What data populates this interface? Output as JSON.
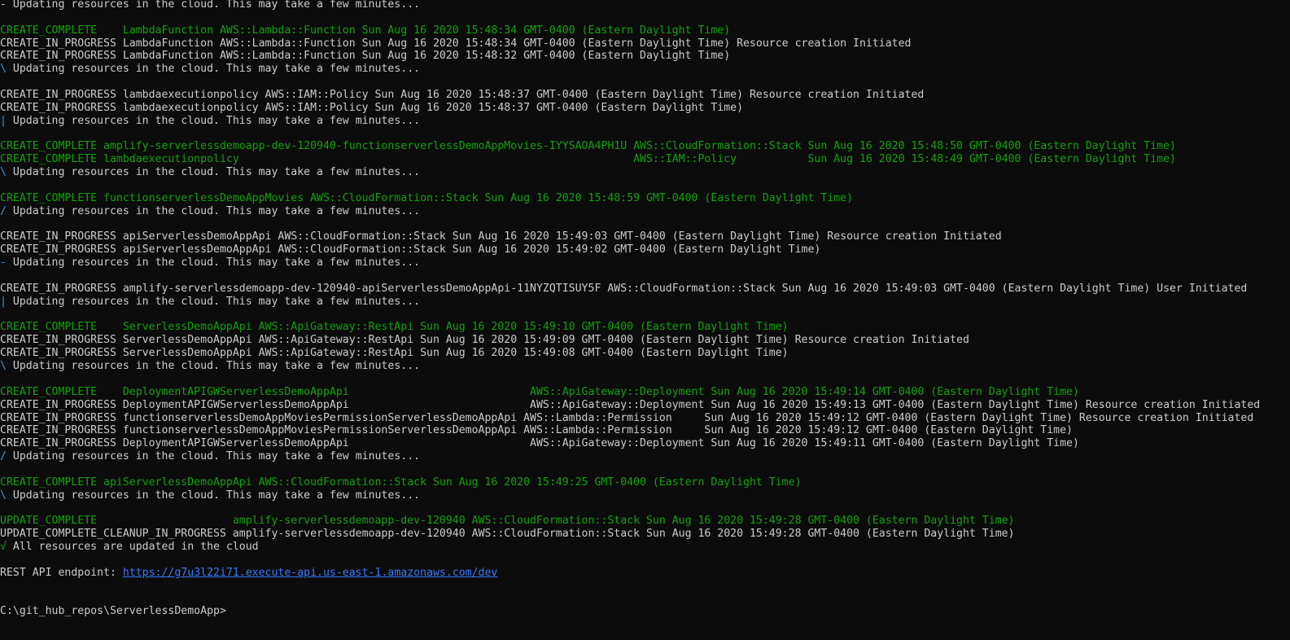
{
  "theme": {
    "background": "#0c0c0c",
    "text": "#cccccc",
    "green": "#13a10e",
    "spinner": "#3a96dd",
    "link": "#3b78ff"
  },
  "lines": [
    {
      "segments": [
        {
          "text": "- Updating resources in the cloud. This may take a few minutes...",
          "color": "white"
        }
      ]
    },
    {
      "segments": []
    },
    {
      "segments": [
        {
          "text": "CREATE_COMPLETE    LambdaFunction AWS::Lambda::Function Sun Aug 16 2020 15:48:34 GMT-0400 (Eastern Daylight Time)",
          "color": "green"
        }
      ]
    },
    {
      "segments": [
        {
          "text": "CREATE_IN_PROGRESS LambdaFunction AWS::Lambda::Function Sun Aug 16 2020 15:48:34 GMT-0400 (Eastern Daylight Time) Resource creation Initiated",
          "color": "white"
        }
      ]
    },
    {
      "segments": [
        {
          "text": "CREATE_IN_PROGRESS LambdaFunction AWS::Lambda::Function Sun Aug 16 2020 15:48:32 GMT-0400 (Eastern Daylight Time)",
          "color": "white"
        }
      ]
    },
    {
      "segments": [
        {
          "text": "\\",
          "color": "cyan"
        },
        {
          "text": " Updating resources in the cloud. This may take a few minutes...",
          "color": "white"
        }
      ]
    },
    {
      "segments": []
    },
    {
      "segments": [
        {
          "text": "CREATE_IN_PROGRESS lambdaexecutionpolicy AWS::IAM::Policy Sun Aug 16 2020 15:48:37 GMT-0400 (Eastern Daylight Time) Resource creation Initiated",
          "color": "white"
        }
      ]
    },
    {
      "segments": [
        {
          "text": "CREATE_IN_PROGRESS lambdaexecutionpolicy AWS::IAM::Policy Sun Aug 16 2020 15:48:37 GMT-0400 (Eastern Daylight Time)",
          "color": "white"
        }
      ]
    },
    {
      "segments": [
        {
          "text": "|",
          "color": "cyan"
        },
        {
          "text": " Updating resources in the cloud. This may take a few minutes...",
          "color": "white"
        }
      ]
    },
    {
      "segments": []
    },
    {
      "segments": [
        {
          "text": "CREATE_COMPLETE amplify-serverlessdemoapp-dev-120940-functionserverlessDemoAppMovies-IYYSAOA4PH1U AWS::CloudFormation::Stack Sun Aug 16 2020 15:48:50 GMT-0400 (Eastern Daylight Time)",
          "color": "green"
        }
      ]
    },
    {
      "segments": [
        {
          "text": "CREATE_COMPLETE lambdaexecutionpolicy                                                             AWS::IAM::Policy           Sun Aug 16 2020 15:48:49 GMT-0400 (Eastern Daylight Time)",
          "color": "green"
        }
      ]
    },
    {
      "segments": [
        {
          "text": "\\",
          "color": "cyan"
        },
        {
          "text": " Updating resources in the cloud. This may take a few minutes...",
          "color": "white"
        }
      ]
    },
    {
      "segments": []
    },
    {
      "segments": [
        {
          "text": "CREATE_COMPLETE functionserverlessDemoAppMovies AWS::CloudFormation::Stack Sun Aug 16 2020 15:48:59 GMT-0400 (Eastern Daylight Time)",
          "color": "green"
        }
      ]
    },
    {
      "segments": [
        {
          "text": "/",
          "color": "cyan"
        },
        {
          "text": " Updating resources in the cloud. This may take a few minutes...",
          "color": "white"
        }
      ]
    },
    {
      "segments": []
    },
    {
      "segments": [
        {
          "text": "CREATE_IN_PROGRESS apiServerlessDemoAppApi AWS::CloudFormation::Stack Sun Aug 16 2020 15:49:03 GMT-0400 (Eastern Daylight Time) Resource creation Initiated",
          "color": "white"
        }
      ]
    },
    {
      "segments": [
        {
          "text": "CREATE_IN_PROGRESS apiServerlessDemoAppApi AWS::CloudFormation::Stack Sun Aug 16 2020 15:49:02 GMT-0400 (Eastern Daylight Time)",
          "color": "white"
        }
      ]
    },
    {
      "segments": [
        {
          "text": "-",
          "color": "cyan"
        },
        {
          "text": " Updating resources in the cloud. This may take a few minutes...",
          "color": "white"
        }
      ]
    },
    {
      "segments": []
    },
    {
      "segments": [
        {
          "text": "CREATE_IN_PROGRESS amplify-serverlessdemoapp-dev-120940-apiServerlessDemoAppApi-11NYZQTISUY5F AWS::CloudFormation::Stack Sun Aug 16 2020 15:49:03 GMT-0400 (Eastern Daylight Time) User Initiated",
          "color": "white"
        }
      ]
    },
    {
      "segments": [
        {
          "text": "|",
          "color": "cyan"
        },
        {
          "text": " Updating resources in the cloud. This may take a few minutes...",
          "color": "white"
        }
      ]
    },
    {
      "segments": []
    },
    {
      "segments": [
        {
          "text": "CREATE_COMPLETE    ServerlessDemoAppApi AWS::ApiGateway::RestApi Sun Aug 16 2020 15:49:10 GMT-0400 (Eastern Daylight Time)",
          "color": "green"
        }
      ]
    },
    {
      "segments": [
        {
          "text": "CREATE_IN_PROGRESS ServerlessDemoAppApi AWS::ApiGateway::RestApi Sun Aug 16 2020 15:49:09 GMT-0400 (Eastern Daylight Time) Resource creation Initiated",
          "color": "white"
        }
      ]
    },
    {
      "segments": [
        {
          "text": "CREATE_IN_PROGRESS ServerlessDemoAppApi AWS::ApiGateway::RestApi Sun Aug 16 2020 15:49:08 GMT-0400 (Eastern Daylight Time)",
          "color": "white"
        }
      ]
    },
    {
      "segments": [
        {
          "text": "\\",
          "color": "cyan"
        },
        {
          "text": " Updating resources in the cloud. This may take a few minutes...",
          "color": "white"
        }
      ]
    },
    {
      "segments": []
    },
    {
      "segments": [
        {
          "text": "CREATE_COMPLETE    DeploymentAPIGWServerlessDemoAppApi                            AWS::ApiGateway::Deployment Sun Aug 16 2020 15:49:14 GMT-0400 (Eastern Daylight Time)",
          "color": "green"
        }
      ]
    },
    {
      "segments": [
        {
          "text": "CREATE_IN_PROGRESS DeploymentAPIGWServerlessDemoAppApi                            AWS::ApiGateway::Deployment Sun Aug 16 2020 15:49:13 GMT-0400 (Eastern Daylight Time) Resource creation Initiated",
          "color": "white"
        }
      ]
    },
    {
      "segments": [
        {
          "text": "CREATE_IN_PROGRESS functionserverlessDemoAppMoviesPermissionServerlessDemoAppApi AWS::Lambda::Permission     Sun Aug 16 2020 15:49:12 GMT-0400 (Eastern Daylight Time) Resource creation Initiated",
          "color": "white"
        }
      ]
    },
    {
      "segments": [
        {
          "text": "CREATE_IN_PROGRESS functionserverlessDemoAppMoviesPermissionServerlessDemoAppApi AWS::Lambda::Permission     Sun Aug 16 2020 15:49:12 GMT-0400 (Eastern Daylight Time)",
          "color": "white"
        }
      ]
    },
    {
      "segments": [
        {
          "text": "CREATE_IN_PROGRESS DeploymentAPIGWServerlessDemoAppApi                            AWS::ApiGateway::Deployment Sun Aug 16 2020 15:49:11 GMT-0400 (Eastern Daylight Time)",
          "color": "white"
        }
      ]
    },
    {
      "segments": [
        {
          "text": "/",
          "color": "cyan"
        },
        {
          "text": " Updating resources in the cloud. This may take a few minutes...",
          "color": "white"
        }
      ]
    },
    {
      "segments": []
    },
    {
      "segments": [
        {
          "text": "CREATE_COMPLETE apiServerlessDemoAppApi AWS::CloudFormation::Stack Sun Aug 16 2020 15:49:25 GMT-0400 (Eastern Daylight Time)",
          "color": "green"
        }
      ]
    },
    {
      "segments": [
        {
          "text": "\\",
          "color": "cyan"
        },
        {
          "text": " Updating resources in the cloud. This may take a few minutes...",
          "color": "white"
        }
      ]
    },
    {
      "segments": []
    },
    {
      "segments": [
        {
          "text": "UPDATE_COMPLETE                     amplify-serverlessdemoapp-dev-120940 AWS::CloudFormation::Stack Sun Aug 16 2020 15:49:28 GMT-0400 (Eastern Daylight Time)",
          "color": "green"
        }
      ]
    },
    {
      "segments": [
        {
          "text": "UPDATE_COMPLETE_CLEANUP_IN_PROGRESS amplify-serverlessdemoapp-dev-120940 AWS::CloudFormation::Stack Sun Aug 16 2020 15:49:28 GMT-0400 (Eastern Daylight Time)",
          "color": "white"
        }
      ]
    },
    {
      "segments": [
        {
          "text": "√",
          "color": "green"
        },
        {
          "text": " All resources are updated in the cloud",
          "color": "white"
        }
      ]
    },
    {
      "segments": []
    },
    {
      "segments": [
        {
          "text": "REST API endpoint: ",
          "color": "white"
        },
        {
          "text": "https://g7u3l22i71.execute-api.us-east-1.amazonaws.com/dev",
          "color": "link",
          "link": true
        }
      ]
    },
    {
      "segments": []
    },
    {
      "segments": []
    },
    {
      "segments": [
        {
          "text": "C:\\git_hub_repos\\ServerlessDemoApp>",
          "color": "white"
        }
      ]
    }
  ]
}
